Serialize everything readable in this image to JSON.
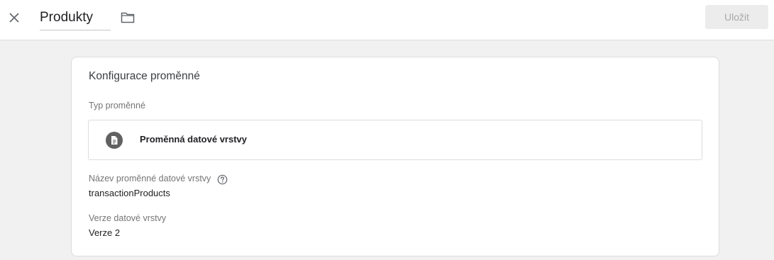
{
  "header": {
    "title": "Produkty",
    "save_label": "Uložit",
    "close_icon": "close-icon",
    "folder_icon": "folder-icon"
  },
  "config": {
    "section_title": "Konfigurace proměnné",
    "type_label": "Typ proměnné",
    "type_value": "Proměnná datové vrstvy",
    "type_icon": "document-icon",
    "name_label": "Název proměnné datové vrstvy",
    "help_icon": "help-icon",
    "name_value": "transactionProducts",
    "version_label": "Verze datové vrstvy",
    "version_value": "Verze 2"
  },
  "colors": {
    "page_background": "#f1f1f1",
    "card_background": "#ffffff",
    "border": "#dadce0",
    "icon_dark": "#616161",
    "save_disabled_bg": "#ececec",
    "save_disabled_text": "#a8a8a8"
  }
}
